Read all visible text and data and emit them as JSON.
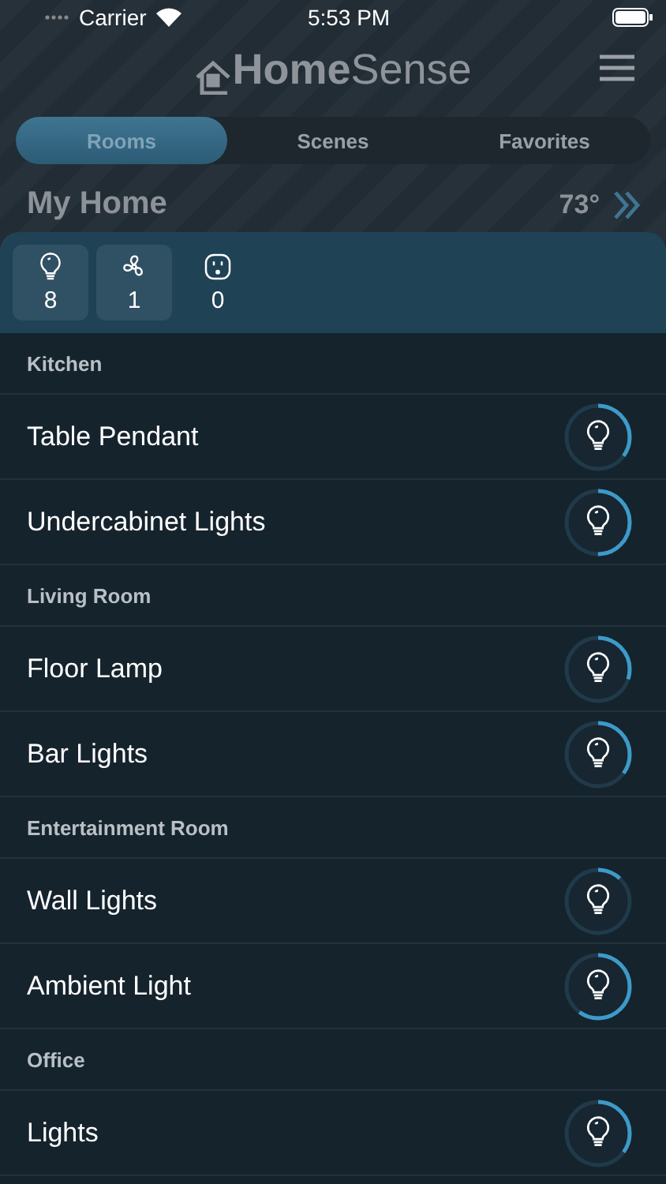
{
  "status_bar": {
    "carrier": "Carrier",
    "time": "5:53 PM"
  },
  "header": {
    "logo_bold": "Home",
    "logo_light": "Sense"
  },
  "tabs": [
    {
      "label": "Rooms",
      "selected": true
    },
    {
      "label": "Scenes",
      "selected": false
    },
    {
      "label": "Favorites",
      "selected": false
    }
  ],
  "home": {
    "title": "My Home",
    "temperature": "73°"
  },
  "summary": [
    {
      "kind": "light",
      "count": "8",
      "active": true
    },
    {
      "kind": "fan",
      "count": "1",
      "active": true
    },
    {
      "kind": "outlet",
      "count": "0",
      "active": false
    }
  ],
  "sections": [
    {
      "title": "Kitchen",
      "devices": [
        {
          "name": "Table Pendant",
          "level": 0.35
        },
        {
          "name": "Undercabinet Lights",
          "level": 0.5
        }
      ]
    },
    {
      "title": "Living Room",
      "devices": [
        {
          "name": "Floor Lamp",
          "level": 0.3
        },
        {
          "name": "Bar Lights",
          "level": 0.35
        }
      ]
    },
    {
      "title": "Entertainment Room",
      "devices": [
        {
          "name": "Wall Lights",
          "level": 0.12
        },
        {
          "name": "Ambient Light",
          "level": 0.6
        }
      ]
    },
    {
      "title": "Office",
      "devices": [
        {
          "name": "Lights",
          "level": 0.35
        }
      ]
    }
  ]
}
